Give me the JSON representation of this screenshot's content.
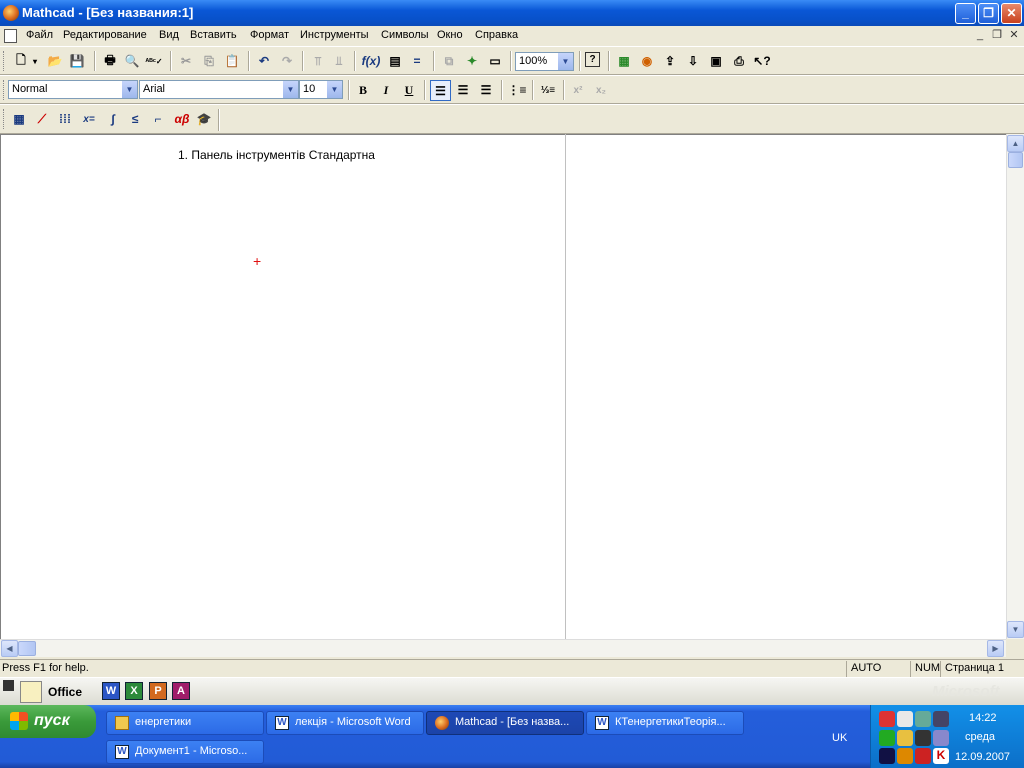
{
  "window": {
    "title": "Mathcad - [Без названия:1]"
  },
  "menu": [
    "Файл",
    "Редактирование",
    "Вид",
    "Вставить",
    "Формат",
    "Инструменты",
    "Символы",
    "Окно",
    "Справка"
  ],
  "toolbar_standard": {
    "zoom": "100%"
  },
  "toolbar_format": {
    "style": "Normal",
    "font": "Arial",
    "size": "10",
    "bold": "B",
    "italic": "I",
    "underline": "U"
  },
  "toolbar_math": {
    "eval_label": "x=",
    "greek_label": "αβ"
  },
  "worksheet": {
    "text_region": "1. Панель інструментів Стандартна",
    "cursor": "+"
  },
  "statusbar": {
    "help": "Press F1 for help.",
    "auto": "AUTO",
    "num": "NUM",
    "page": "Страница 1"
  },
  "officebar": {
    "label": "Office",
    "watermark": "Microsoft"
  },
  "taskbar": {
    "start": "пуск",
    "tasks_row1": [
      "енергетики",
      "лекція - Microsoft Word",
      "Mathcad - [Без назва...",
      "КТенергетикиТеорія..."
    ],
    "tasks_row2": [
      "Документ1 - Microso..."
    ],
    "lang": "UK",
    "time": "14:22",
    "day": "среда",
    "date": "12.09.2007"
  },
  "colors": {
    "titlebar": "#0a57d6",
    "taskbar": "#245edb",
    "start": "#3a9a3a",
    "cursor": "#e01010"
  }
}
